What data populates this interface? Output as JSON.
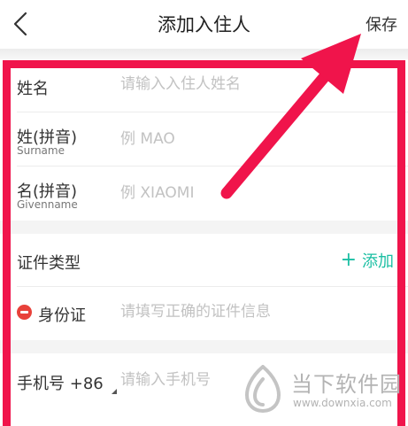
{
  "header": {
    "title": "添加入住人",
    "save_label": "保存"
  },
  "form": {
    "name": {
      "label": "姓名",
      "placeholder": "请输入入住人姓名"
    },
    "surname": {
      "label": "姓(拼音)",
      "sublabel": "Surname",
      "placeholder": "例 MAO"
    },
    "givenname": {
      "label": "名(拼音)",
      "sublabel": "Givenname",
      "placeholder": "例 XIAOMI"
    },
    "id_type": {
      "label": "证件类型",
      "add_label": "添加",
      "add_icon": "plus-icon"
    },
    "id_card": {
      "label": "身份证",
      "placeholder": "请填写正确的证件信息",
      "remove_icon": "minus-circle-icon"
    },
    "phone": {
      "label": "手机号",
      "country_code": "+86",
      "placeholder": "请输入手机号"
    }
  },
  "watermark": {
    "name": "当下软件园",
    "url": "www.downxia.com"
  },
  "colors": {
    "accent": "#1bbfa3",
    "remove": "#e8413a",
    "annotation": "#f0144b"
  }
}
